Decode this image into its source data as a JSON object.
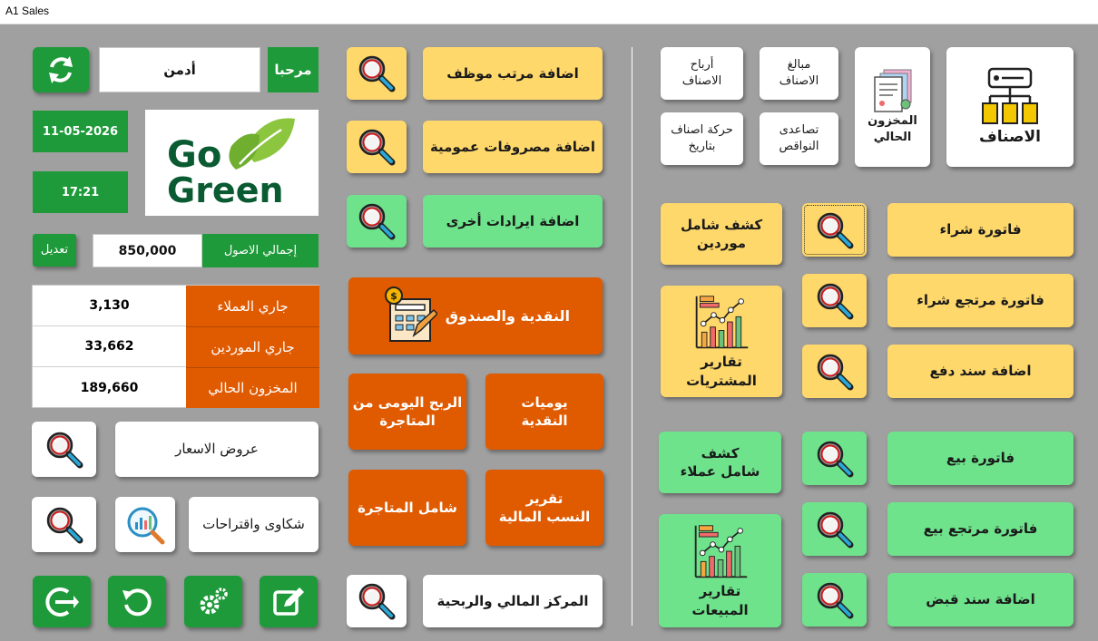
{
  "window": {
    "title": "A1 Sales"
  },
  "header": {
    "welcome": "مرحبا",
    "user_name": "أدمن",
    "date": "11-05-2026",
    "time": "17:21",
    "logo_line1": "Go",
    "logo_line2": "Green",
    "total_assets_label": "إجمالي الاصول",
    "total_assets_value": "850,000",
    "edit_label": "تعديل"
  },
  "balances": [
    {
      "label": "جاري العملاء",
      "value": "3,130"
    },
    {
      "label": "جاري الموردين",
      "value": "33,662"
    },
    {
      "label": "المخزون الحالي",
      "value": "189,660"
    }
  ],
  "left_actions": {
    "price_offers": "عروض الاسعار",
    "complaints": "شكاوى واقتراحات"
  },
  "middle": {
    "add_salary": "اضافة مرتب موظف",
    "add_expenses": "اضافة مصروفات عمومية",
    "add_revenues": "اضافة ايرادات أخرى",
    "cash_box": "النقدية والصندوق",
    "cash_daily": "يوميات\nالنقدية",
    "daily_profit": "الربح اليومى من\nالمتاجرة",
    "financial_ratios": "تقرير\nالنسب المالية",
    "total_trading": "شامل المتاجرة",
    "financial_position": "المركز المالي والربحية"
  },
  "right": {
    "items": "الاصناف",
    "current_stock": "المخزون\nالحالي",
    "items_amounts": "مبالغ\nالاصناف",
    "items_profits": "أرباح\nالاصناف",
    "shortages": "تصاعدى\nالنواقص",
    "items_movement": "حركة اصناف\nبتاريخ",
    "purchase_invoice": "فاتورة شراء",
    "purchase_return": "فاتورة مرتجع شراء",
    "payment_voucher": "اضافة سند دفع",
    "suppliers_statement": "كشف شامل\nموردين",
    "purchases_reports": "تقارير\nالمشتريات",
    "sales_invoice": "فاتورة بيع",
    "sales_return": "فاتورة مرتجع بيع",
    "receipt_voucher": "اضافة سند قبض",
    "customers_statement": "كشف\nشامل عملاء",
    "sales_reports": "تقارير\nالمبيعات"
  },
  "colors": {
    "background": "#a0a0a0",
    "yellow": "#ffd86b",
    "green": "#6ee38c",
    "orange": "#e05a00",
    "dark_green": "#1e9a3a"
  }
}
